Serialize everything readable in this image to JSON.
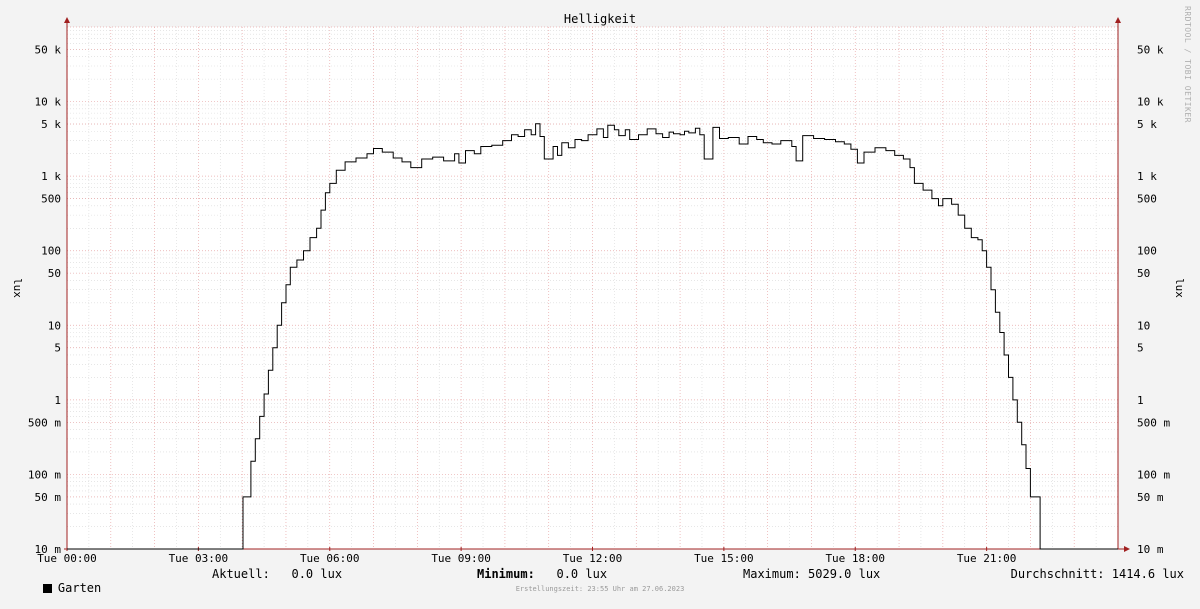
{
  "chart_data": {
    "type": "line",
    "title": "Helligkeit",
    "ylabel": "lux",
    "y_scale": "log",
    "ylim": [
      0.01,
      100000
    ],
    "x_unit": "hour of day",
    "xlim": [
      0,
      24
    ],
    "x_ticks": [
      {
        "x": 0,
        "label": "Tue 00:00"
      },
      {
        "x": 3,
        "label": "Tue 03:00"
      },
      {
        "x": 6,
        "label": "Tue 06:00"
      },
      {
        "x": 9,
        "label": "Tue 09:00"
      },
      {
        "x": 12,
        "label": "Tue 12:00"
      },
      {
        "x": 15,
        "label": "Tue 15:00"
      },
      {
        "x": 18,
        "label": "Tue 18:00"
      },
      {
        "x": 21,
        "label": "Tue 21:00"
      }
    ],
    "y_ticks": [
      {
        "y": 50000,
        "label": "50 k"
      },
      {
        "y": 10000,
        "label": "10 k"
      },
      {
        "y": 5000,
        "label": "5 k"
      },
      {
        "y": 1000,
        "label": "1 k"
      },
      {
        "y": 500,
        "label": "500"
      },
      {
        "y": 100,
        "label": "100"
      },
      {
        "y": 50,
        "label": "50"
      },
      {
        "y": 10,
        "label": "10"
      },
      {
        "y": 5,
        "label": "5"
      },
      {
        "y": 1,
        "label": "1"
      },
      {
        "y": 0.5,
        "label": "500 m"
      },
      {
        "y": 0.1,
        "label": "100 m"
      },
      {
        "y": 0.05,
        "label": "50 m"
      },
      {
        "y": 0.01,
        "label": "10 m"
      }
    ],
    "grid": true,
    "series": [
      {
        "name": "Garten",
        "color": "#000000",
        "points": [
          [
            0,
            0.01
          ],
          [
            4.0,
            0.01
          ],
          [
            4.02,
            0.05
          ],
          [
            4.15,
            0.05
          ],
          [
            4.2,
            0.15
          ],
          [
            4.3,
            0.3
          ],
          [
            4.4,
            0.6
          ],
          [
            4.5,
            1.2
          ],
          [
            4.6,
            2.5
          ],
          [
            4.7,
            5
          ],
          [
            4.8,
            10
          ],
          [
            4.9,
            20
          ],
          [
            5.0,
            35
          ],
          [
            5.1,
            60
          ],
          [
            5.25,
            75
          ],
          [
            5.4,
            100
          ],
          [
            5.55,
            150
          ],
          [
            5.7,
            200
          ],
          [
            5.8,
            350
          ],
          [
            5.9,
            600
          ],
          [
            6.0,
            800
          ],
          [
            6.15,
            1200
          ],
          [
            6.35,
            1550
          ],
          [
            6.6,
            1750
          ],
          [
            6.85,
            2000
          ],
          [
            7.0,
            2350
          ],
          [
            7.2,
            2100
          ],
          [
            7.45,
            1750
          ],
          [
            7.65,
            1550
          ],
          [
            7.85,
            1300
          ],
          [
            8.1,
            1700
          ],
          [
            8.35,
            1800
          ],
          [
            8.6,
            1600
          ],
          [
            8.85,
            2000
          ],
          [
            8.95,
            1500
          ],
          [
            9.1,
            2200
          ],
          [
            9.3,
            2000
          ],
          [
            9.45,
            2500
          ],
          [
            9.7,
            2600
          ],
          [
            9.95,
            3000
          ],
          [
            10.15,
            3600
          ],
          [
            10.3,
            3400
          ],
          [
            10.45,
            4200
          ],
          [
            10.6,
            3600
          ],
          [
            10.7,
            5029
          ],
          [
            10.8,
            3400
          ],
          [
            10.9,
            1700
          ],
          [
            11.1,
            2500
          ],
          [
            11.2,
            1900
          ],
          [
            11.3,
            2800
          ],
          [
            11.45,
            2400
          ],
          [
            11.6,
            3100
          ],
          [
            11.75,
            3000
          ],
          [
            11.9,
            3600
          ],
          [
            12.1,
            4300
          ],
          [
            12.25,
            3300
          ],
          [
            12.35,
            4800
          ],
          [
            12.5,
            4200
          ],
          [
            12.6,
            3500
          ],
          [
            12.75,
            4200
          ],
          [
            12.85,
            3100
          ],
          [
            13.05,
            3600
          ],
          [
            13.25,
            4300
          ],
          [
            13.45,
            3700
          ],
          [
            13.6,
            3300
          ],
          [
            13.75,
            3900
          ],
          [
            13.85,
            3700
          ],
          [
            14.0,
            3600
          ],
          [
            14.1,
            4000
          ],
          [
            14.2,
            3800
          ],
          [
            14.35,
            4400
          ],
          [
            14.45,
            3600
          ],
          [
            14.55,
            1700
          ],
          [
            14.75,
            4500
          ],
          [
            14.9,
            3200
          ],
          [
            15.1,
            3300
          ],
          [
            15.35,
            2700
          ],
          [
            15.55,
            3400
          ],
          [
            15.75,
            3100
          ],
          [
            15.9,
            2800
          ],
          [
            16.1,
            2700
          ],
          [
            16.3,
            3000
          ],
          [
            16.55,
            2500
          ],
          [
            16.65,
            1600
          ],
          [
            16.8,
            3500
          ],
          [
            17.05,
            3200
          ],
          [
            17.3,
            3100
          ],
          [
            17.55,
            2900
          ],
          [
            17.75,
            2700
          ],
          [
            17.9,
            2300
          ],
          [
            18.05,
            1500
          ],
          [
            18.2,
            2100
          ],
          [
            18.45,
            2400
          ],
          [
            18.7,
            2200
          ],
          [
            18.9,
            1900
          ],
          [
            19.1,
            1700
          ],
          [
            19.25,
            1300
          ],
          [
            19.35,
            800
          ],
          [
            19.55,
            650
          ],
          [
            19.75,
            500
          ],
          [
            19.9,
            400
          ],
          [
            20.0,
            500
          ],
          [
            20.2,
            420
          ],
          [
            20.35,
            300
          ],
          [
            20.5,
            200
          ],
          [
            20.65,
            150
          ],
          [
            20.8,
            140
          ],
          [
            20.9,
            100
          ],
          [
            21.0,
            60
          ],
          [
            21.1,
            30
          ],
          [
            21.2,
            15
          ],
          [
            21.3,
            8
          ],
          [
            21.4,
            4
          ],
          [
            21.5,
            2
          ],
          [
            21.6,
            1
          ],
          [
            21.7,
            0.5
          ],
          [
            21.8,
            0.25
          ],
          [
            21.9,
            0.12
          ],
          [
            22.0,
            0.05
          ],
          [
            22.05,
            0.05
          ],
          [
            22.2,
            0.05
          ],
          [
            22.22,
            0.01
          ],
          [
            24,
            0.01
          ]
        ]
      }
    ]
  },
  "legend": {
    "series_name": "Garten",
    "aktuell": "Aktuell:   0.0 lux",
    "minimum_label": "Minimum:",
    "minimum_value": "   0.0 lux",
    "maximum": "Maximum: 5029.0 lux",
    "durchschnitt": "Durchschnitt: 1414.6 lux"
  },
  "footer": "Erstellungszeit: 23:55 Uhr am 27.06.2023",
  "watermark": "RRDTOOL / TOBI OETIKER",
  "colors": {
    "background": "#f3f3f3",
    "plot": "#ffffff",
    "grid_major": "#e8a8a8",
    "grid_minor": "#d8d8d8",
    "line": "#000000",
    "arrow": "#a02020"
  }
}
